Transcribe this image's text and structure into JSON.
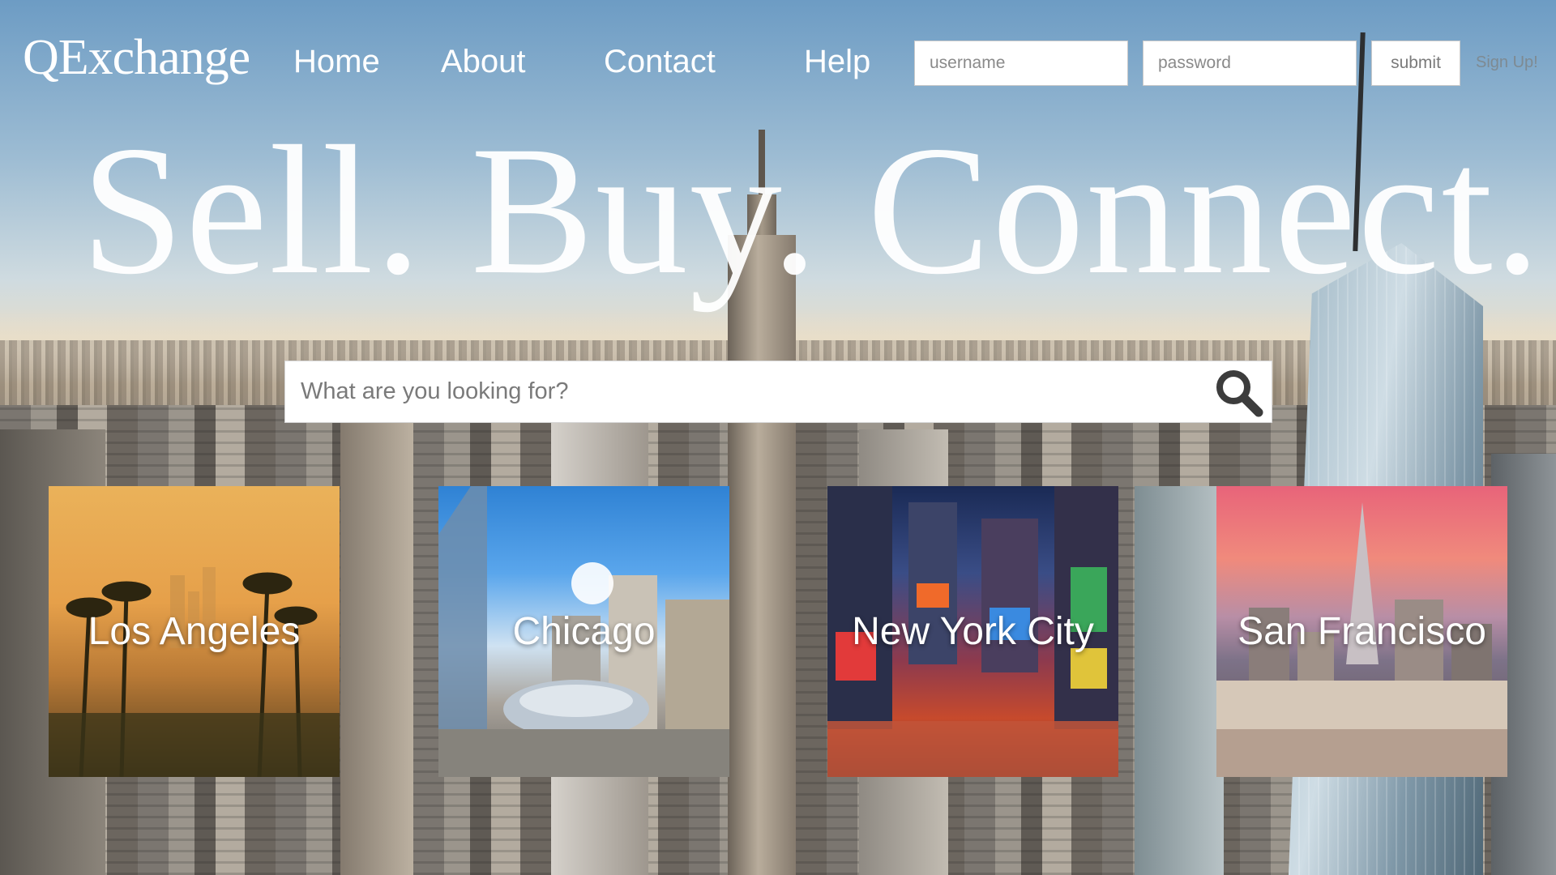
{
  "header": {
    "logo": "QExchange",
    "nav": [
      {
        "label": "Home"
      },
      {
        "label": "About"
      },
      {
        "label": "Contact"
      },
      {
        "label": "Help"
      }
    ],
    "login": {
      "username_placeholder": "username",
      "password_placeholder": "password",
      "submit_label": "submit",
      "signup_label": "Sign Up!"
    }
  },
  "hero": {
    "tagline": "Sell. Buy. Connect."
  },
  "search": {
    "placeholder": "What are you looking for?",
    "icon": "search-icon"
  },
  "cities": [
    {
      "label": "Los Angeles"
    },
    {
      "label": "Chicago"
    },
    {
      "label": "New York City"
    },
    {
      "label": "San Francisco"
    }
  ]
}
